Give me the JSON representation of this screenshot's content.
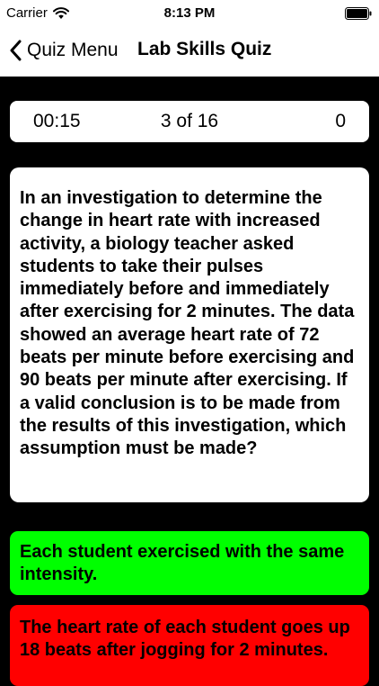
{
  "status_bar": {
    "carrier": "Carrier",
    "time": "8:13 PM"
  },
  "nav": {
    "back_label": "Quiz Menu",
    "title": "Lab Skills Quiz"
  },
  "score_bar": {
    "timer": "00:15",
    "progress": "3 of 16",
    "score": "0"
  },
  "question": {
    "text": "In an investigation to determine the change in heart rate with increased activity, a biology teacher asked students to take their pulses immediately before and immediately after exercising for 2 minutes. The data showed an average heart rate of 72 beats per minute before exercising and 90 beats per minute after exercising. If a valid conclusion is to be made from the results of this investigation, which assumption must be made?"
  },
  "answers": [
    {
      "text": "Each student exercised with the same intensity.",
      "color": "#00ff00"
    },
    {
      "text": " The heart rate of each student goes up 18 beats after jogging for 2 minutes.",
      "color": "#ff0000"
    }
  ],
  "colors": {
    "background": "#000000",
    "bar": "#ffffff"
  },
  "icons": {
    "wifi": "wifi-icon",
    "battery": "battery-icon",
    "back": "chevron-left-icon"
  }
}
